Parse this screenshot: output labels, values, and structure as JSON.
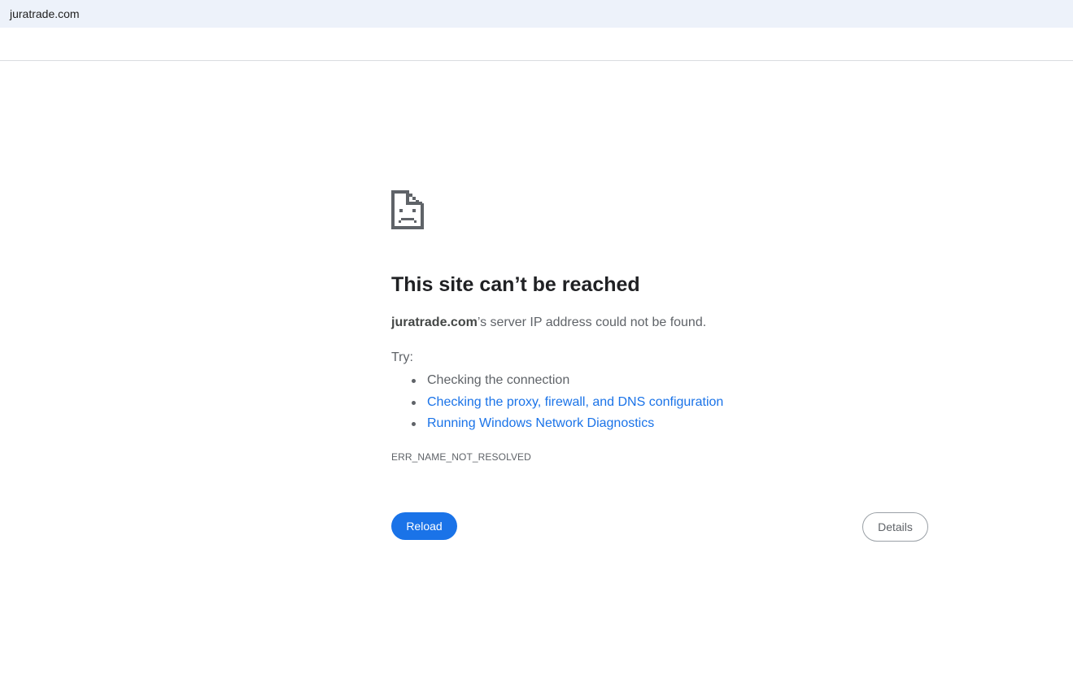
{
  "address_bar": {
    "url": "juratrade.com"
  },
  "error_page": {
    "icon": "sad-document-icon",
    "title": "This site can’t be reached",
    "host": "juratrade.com",
    "message_suffix": "’s server IP address could not be found.",
    "try_label": "Try:",
    "suggestions": [
      {
        "label": "Checking the connection",
        "is_link": false
      },
      {
        "label": "Checking the proxy, firewall, and DNS configuration",
        "is_link": true
      },
      {
        "label": "Running Windows Network Diagnostics",
        "is_link": true
      }
    ],
    "error_code": "ERR_NAME_NOT_RESOLVED",
    "reload_label": "Reload",
    "details_label": "Details"
  },
  "colors": {
    "accent": "#1a73e8",
    "text": "#5f6368",
    "title": "#202124",
    "address_bar_bg": "#edf2fa"
  }
}
